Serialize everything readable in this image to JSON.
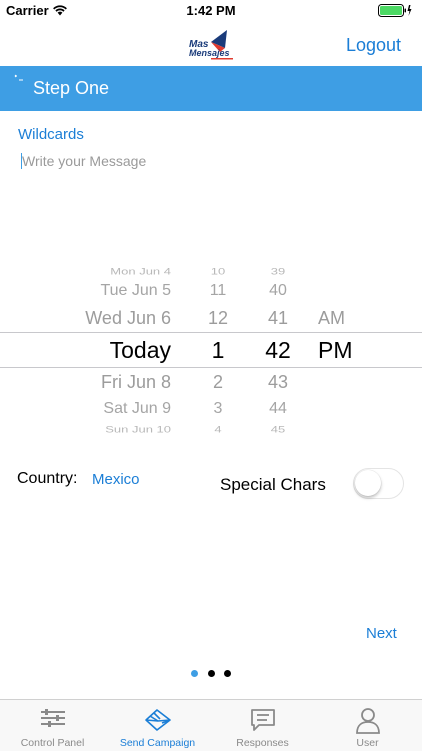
{
  "status_bar": {
    "carrier": "Carrier",
    "time": "1:42 PM"
  },
  "nav": {
    "logo_line1": "Mas",
    "logo_line2": "Mensajes",
    "logout": "Logout"
  },
  "step": {
    "title": "Step One"
  },
  "wildcards": "Wildcards",
  "message": {
    "placeholder": "Write your Message",
    "value": ""
  },
  "picker": {
    "dates": [
      "Mon Jun 4",
      "Tue Jun 5",
      "Wed Jun 6",
      "Today",
      "Fri Jun 8",
      "Sat Jun 9",
      "Sun Jun 10"
    ],
    "hours": [
      "10",
      "11",
      "12",
      "1",
      "2",
      "3",
      "4"
    ],
    "minutes": [
      "39",
      "40",
      "41",
      "42",
      "43",
      "44",
      "45"
    ],
    "ampm": [
      "AM",
      "PM"
    ],
    "selected": {
      "date": "Today",
      "hour": "1",
      "minute": "42",
      "ampm": "PM"
    }
  },
  "country": {
    "label": "Country:",
    "value": "Mexico"
  },
  "special_chars": {
    "label": "Special Chars",
    "enabled": false
  },
  "next": "Next",
  "pagination": {
    "count": 3,
    "current": 0
  },
  "colors": {
    "accent": "#1b7ed6",
    "header_bar": "#3e9ee4",
    "inactive_dot": "#000000"
  },
  "tabs": [
    {
      "label": "Control Panel",
      "icon": "sliders-icon",
      "active": false
    },
    {
      "label": "Send Campaign",
      "icon": "envelope-send-icon",
      "active": true
    },
    {
      "label": "Responses",
      "icon": "message-icon",
      "active": false
    },
    {
      "label": "User",
      "icon": "user-icon",
      "active": false
    }
  ]
}
